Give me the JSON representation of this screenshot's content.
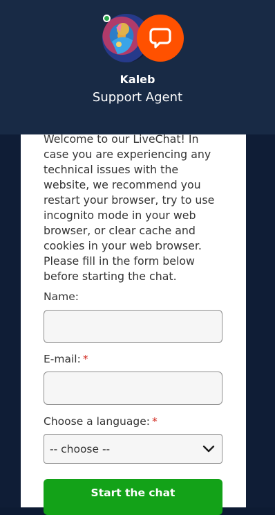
{
  "agent": {
    "name": "Kaleb",
    "role": "Support Agent",
    "status_color": "#2aa84a"
  },
  "brand": {
    "icon": "chat-bubble-icon",
    "color": "#ff5100"
  },
  "welcome_message": "Welcome to our LiveChat! In case you are experiencing any technical issues with the website, we recommend you restart your browser, try to use incognito mode in your web browser, or clear cache and cookies in your web browser.\nPlease fill in the form below before starting the chat.",
  "form": {
    "name_label": "Name:",
    "name_value": "",
    "email_label": "E-mail:",
    "email_value": "",
    "required_marker": "*",
    "language_label": "Choose a language:",
    "language_selected": "-- choose --",
    "submit_label": "Start the chat"
  },
  "colors": {
    "header": "#182a45",
    "button": "#13a218",
    "required": "#d0281e"
  }
}
